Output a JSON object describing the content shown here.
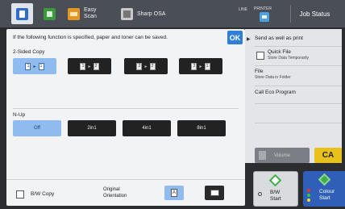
{
  "topbar": {
    "tabs": [
      {
        "label": "",
        "icon": "copy-icon"
      },
      {
        "label": "",
        "icon": "document-filing-icon"
      },
      {
        "label_line1": "Easy",
        "label_line2": "Scan",
        "icon": "easy-scan-icon"
      },
      {
        "label": "Sharp OSA",
        "icon": "sharp-osa-icon"
      }
    ],
    "line_label": "LINE",
    "printer_label": "PRINTER",
    "job_status": "Job Status"
  },
  "panel": {
    "description": "If the following function is specified, paper and toner can be saved.",
    "ok_label": "OK",
    "two_sided": {
      "label": "2-Sided Copy",
      "options": [
        {
          "from": "1",
          "to": "1",
          "selected": true
        },
        {
          "from": "1",
          "to": "2",
          "selected": false
        },
        {
          "from": "2",
          "to": "2",
          "selected": false
        },
        {
          "from": "2",
          "to": "1",
          "selected": false
        }
      ]
    },
    "n_up": {
      "label": "N-Up",
      "options": [
        {
          "label": "Off",
          "selected": true
        },
        {
          "label": "2in1",
          "selected": false
        },
        {
          "label": "4in1",
          "selected": false
        },
        {
          "label": "8in1",
          "selected": false
        }
      ]
    },
    "bw_copy_label": "B/W Copy",
    "orientation_label_line1": "Original",
    "orientation_label_line2": "Orientation",
    "orientation_selected": "portrait"
  },
  "right_panel": {
    "items": [
      {
        "title": "Send as well as print",
        "sub": ""
      },
      {
        "title": "Quick File",
        "sub": "Store Data Temporarily"
      },
      {
        "title": "File",
        "sub": "Store Data in Folder"
      },
      {
        "title": "Call Eco Program",
        "sub": ""
      }
    ]
  },
  "controls": {
    "volume_label": "Volume",
    "ca_label": "CA",
    "bw_start_line1": "B/W",
    "bw_start_line2": "Start",
    "colour_start_line1": "Colour",
    "colour_start_line2": "Start"
  },
  "colors": {
    "accent": "#2f7fd6",
    "selected": "#8fbbef",
    "ca": "#e8c11a",
    "start_green": "#3fae49"
  }
}
